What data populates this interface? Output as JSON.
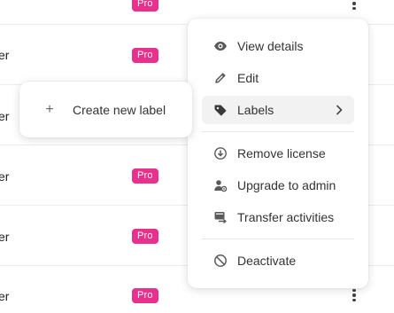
{
  "rows": [
    {
      "cut_text": "er",
      "badge": "Pro"
    },
    {
      "cut_text": "er",
      "badge": "Pro"
    },
    {
      "cut_text": "er",
      "badge": "Pro"
    },
    {
      "cut_text": "er",
      "badge": "Pro"
    },
    {
      "cut_text": "er",
      "badge": "Pro"
    }
  ],
  "menu": {
    "items": [
      {
        "label": "View details",
        "icon": "eye-icon"
      },
      {
        "label": "Edit",
        "icon": "pencil-icon"
      },
      {
        "label": "Labels",
        "icon": "tag-icon",
        "has_submenu": true
      },
      {
        "label": "Remove license",
        "icon": "download-circle-icon"
      },
      {
        "label": "Upgrade to admin",
        "icon": "user-gear-icon"
      },
      {
        "label": "Transfer activities",
        "icon": "transfer-icon"
      },
      {
        "label": "Deactivate",
        "icon": "ban-icon"
      }
    ]
  },
  "submenu": {
    "create_label": "Create new label"
  },
  "colors": {
    "pro_badge": "#e8318c",
    "active_item_bg": "#f2f2f2"
  }
}
